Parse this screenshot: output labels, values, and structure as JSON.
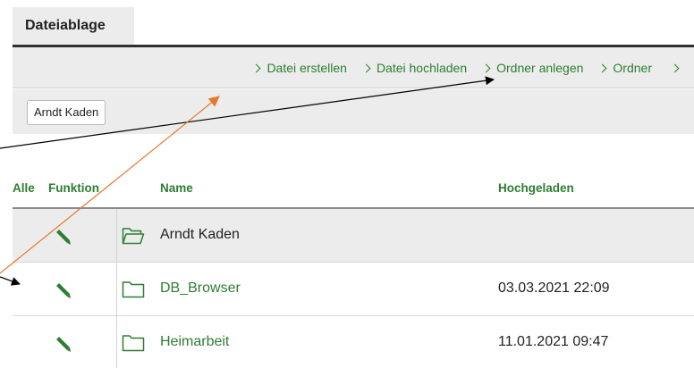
{
  "tab": {
    "label": "Dateiablage"
  },
  "actions": [
    {
      "label": "Datei erstellen"
    },
    {
      "label": "Datei hochladen"
    },
    {
      "label": "Ordner anlegen"
    },
    {
      "label": "Ordner"
    }
  ],
  "filter": {
    "label": "Arndt Kaden"
  },
  "table": {
    "columns": {
      "alle": "Alle",
      "funktion": "Funktion",
      "name": "Name",
      "hochgeladen": "Hochgeladen"
    },
    "rows": [
      {
        "name": "Arndt Kaden",
        "date": "",
        "icon": "folder-open-icon"
      },
      {
        "name": "DB_Browser",
        "date": "03.03.2021 22:09",
        "icon": "folder-icon"
      },
      {
        "name": "Heimarbeit",
        "date": "11.01.2021 09:47",
        "icon": "folder-icon"
      }
    ]
  },
  "colors": {
    "accent_green": "#2e7d32",
    "bar_gray": "#ececec",
    "arrow_orange": "#e8772e",
    "arrow_black": "#000000"
  }
}
